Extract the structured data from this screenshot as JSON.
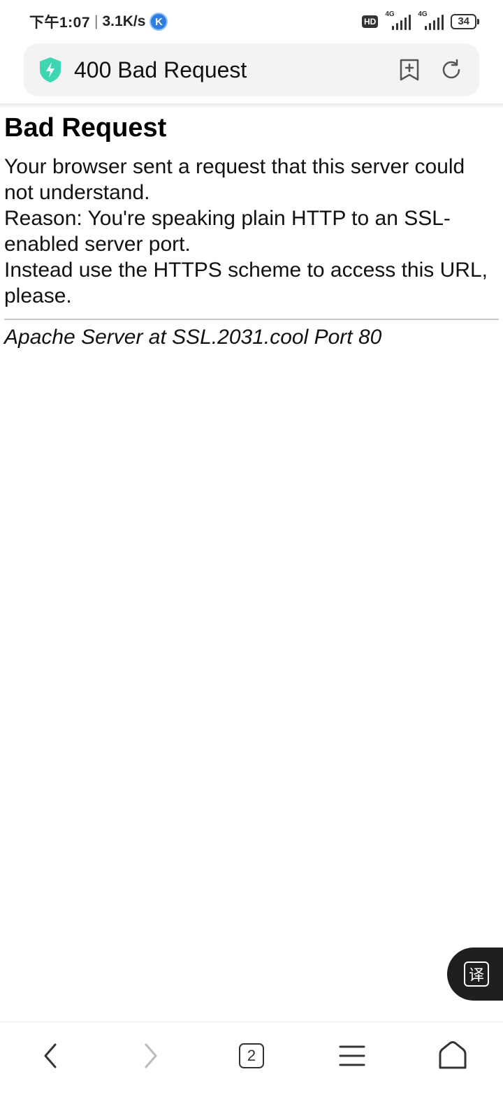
{
  "status_bar": {
    "time": "下午1:07",
    "separator": "|",
    "speed": "3.1K/s",
    "app_badge": "K",
    "hd_label": "HD",
    "network_1": "4G",
    "network_2": "4G",
    "battery": "34"
  },
  "address_bar": {
    "title": "400 Bad Request",
    "shield_color": "#3dd6b3"
  },
  "page": {
    "heading": "Bad Request",
    "line1": "Your browser sent a request that this server could not understand.",
    "line2": "Reason: You're speaking plain HTTP to an SSL-enabled server port.",
    "line3": "Instead use the HTTPS scheme to access this URL, please.",
    "footer": "Apache Server at SSL.2031.cool Port 80"
  },
  "translate_button": {
    "label": "译"
  },
  "bottom_nav": {
    "tab_count": "2",
    "icons": [
      "back-icon",
      "forward-icon",
      "tabs-icon",
      "menu-icon",
      "home-icon"
    ]
  }
}
